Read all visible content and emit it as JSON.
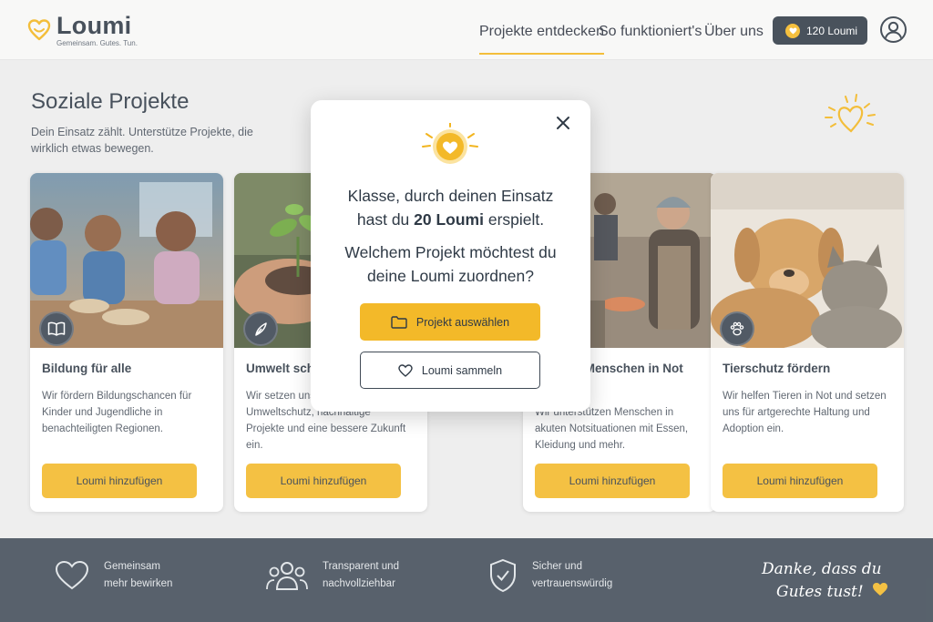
{
  "brand": {
    "name": "Loumi",
    "tagline": "Gemeinsam. Gutes. Tun."
  },
  "nav": [
    {
      "label": "Projekte entdecken",
      "active": true
    },
    {
      "label": "So funktioniert's",
      "active": false
    },
    {
      "label": "Über uns",
      "active": false
    }
  ],
  "points": {
    "label": "120 Loumi"
  },
  "intro": {
    "title": "Soziale Projekte",
    "subtitle": "Dein Einsatz zählt. Unterstütze Projekte, die wirklich etwas bewegen."
  },
  "cards": [
    {
      "title": "Bildung für alle",
      "text": "Wir fördern Bildungschancen für Kinder und Jugendliche in benachteiligten Regionen.",
      "button": "Loumi hinzufügen",
      "icon": "book-icon"
    },
    {
      "title": "Umwelt schützen",
      "text": "Wir setzen uns für Klima- und Umweltschutz, nachhaltige Projekte und eine bessere Zukunft ein.",
      "button": "Loumi hinzufügen",
      "icon": "sprout-icon"
    },
    {
      "title": "Hilfe für Menschen in Not",
      "text": "Wir unterstützen Menschen in akuten Notsituationen mit Essen, Kleidung und mehr.",
      "button": "Loumi hinzufügen",
      "icon": "heart-icon"
    },
    {
      "title": "Tierschutz fördern",
      "text": "Wir helfen Tieren in Not und setzen uns für artgerechte Haltung und Adoption ein.",
      "button": "Loumi hinzufügen",
      "icon": "paw-icon"
    }
  ],
  "footer": {
    "features": [
      {
        "line1": "Gemeinsam",
        "line2": "mehr bewirken",
        "icon": "heart-outline-icon"
      },
      {
        "line1": "Transparent und",
        "line2": "nachvollziehbar",
        "icon": "people-icon"
      },
      {
        "line1": "Sicher und",
        "line2": "vertrauenswürdig",
        "icon": "shield-check-icon"
      }
    ],
    "thanks_line1": "Danke, dass du",
    "thanks_line2": "Gutes tust!"
  },
  "modal": {
    "line1_a": "Klasse, durch deinen Einsatz",
    "line1_b_prefix": "hast du ",
    "line1_b_bold": "20 Loumi",
    "line1_b_suffix": " erspielt.",
    "line2_a": "Welchem Projekt möchtest du",
    "line2_b": "deine Loumi zuordnen?",
    "primary_button": "Projekt auswählen",
    "secondary_button": "Loumi sammeln"
  },
  "colors": {
    "accent": "#f3b929",
    "dark": "#303b46",
    "footer": "#414c58"
  }
}
